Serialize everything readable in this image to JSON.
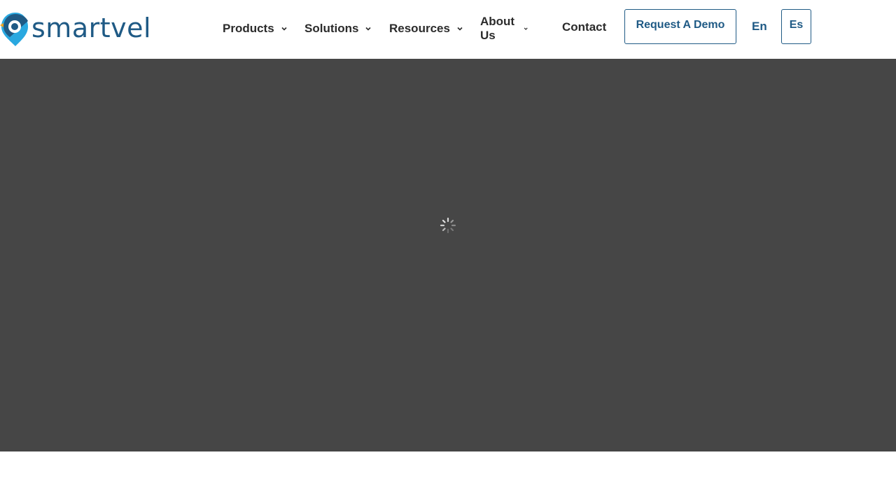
{
  "brand": {
    "name": "smartvel",
    "color": "#1f5a85",
    "accent": "#29a8e0",
    "dot_color": "#f2a31b"
  },
  "nav": {
    "items": [
      {
        "label": "Products",
        "has_dropdown": true
      },
      {
        "label": "Solutions",
        "has_dropdown": true
      },
      {
        "label": "Resources",
        "has_dropdown": true
      },
      {
        "label": "About Us",
        "has_dropdown": true
      },
      {
        "label": "Contact",
        "has_dropdown": false
      }
    ],
    "cta_label": "Request A Demo",
    "languages": [
      "En",
      "Es"
    ]
  },
  "hero": {
    "background": "#464646",
    "state_icon": "loading-spinner-icon"
  }
}
